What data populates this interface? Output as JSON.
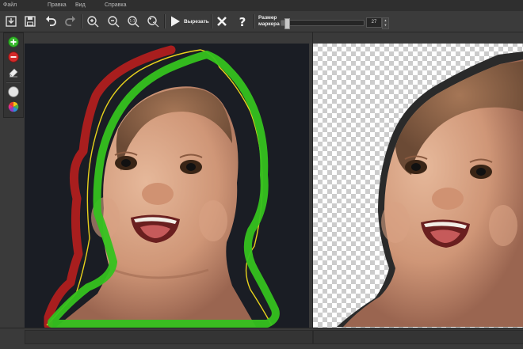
{
  "menu": {
    "file": "Файл",
    "edit": "Правка",
    "view": "Вид",
    "help": "Справка"
  },
  "toolbar": {
    "cut_label": "Вырезать",
    "marker_size_label": "Размер маркера",
    "marker_size_value": "27",
    "marker_slider_fraction": 0.06
  },
  "icons": {
    "open": "open-file-icon",
    "save": "save-icon",
    "undo": "undo-icon",
    "redo": "redo-icon",
    "zoom_in": "zoom-in-icon",
    "zoom_out": "zoom-out-icon",
    "zoom_actual": "zoom-actual-icon",
    "zoom_fit": "zoom-fit-icon",
    "cut": "play-icon",
    "close": "close-icon",
    "help": "help-icon",
    "keep_marker": "plus-circle-icon",
    "remove_marker": "minus-circle-icon",
    "eraser": "eraser-icon",
    "background_white": "white-circle-icon",
    "background_color": "color-wheel-icon"
  },
  "colors": {
    "keep_marker": "#35c21f",
    "remove_marker": "#a81e1e",
    "outline": "#e8d21c",
    "panel_bg": "#3a3a3a",
    "toolbar_bg": "#3b3b3b"
  }
}
